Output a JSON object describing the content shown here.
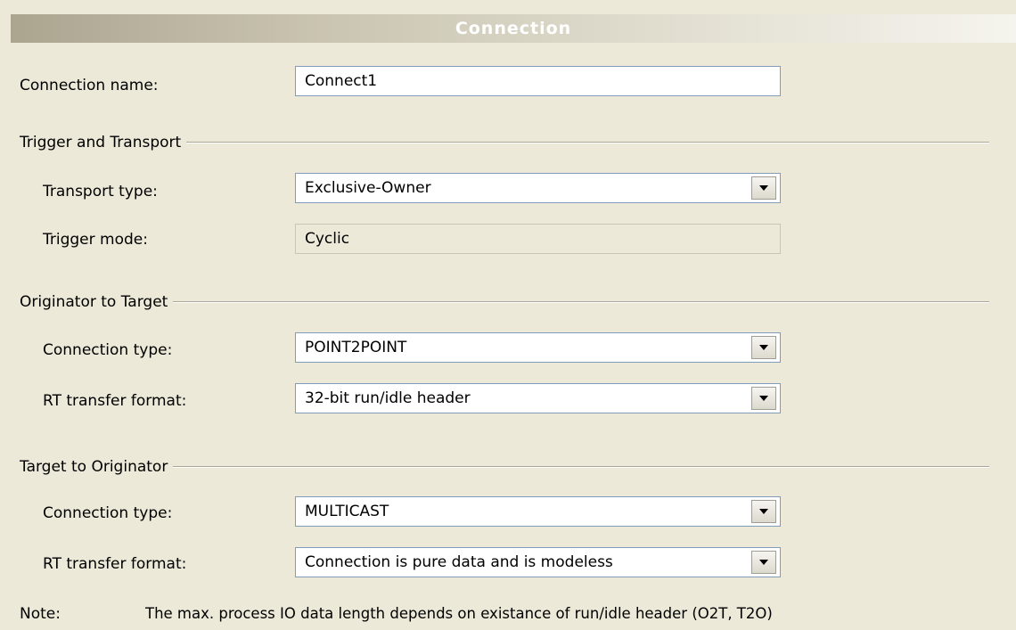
{
  "title": "Connection",
  "connection_name": {
    "label": "Connection name:",
    "value": "Connect1"
  },
  "trigger_transport": {
    "heading": "Trigger and Transport",
    "transport_type": {
      "label": "Transport type:",
      "value": "Exclusive-Owner"
    },
    "trigger_mode": {
      "label": "Trigger mode:",
      "value": "Cyclic"
    }
  },
  "o2t": {
    "heading": "Originator to Target",
    "connection_type": {
      "label": "Connection type:",
      "value": "POINT2POINT"
    },
    "rt_format": {
      "label": "RT transfer format:",
      "value": "32-bit run/idle header"
    }
  },
  "t2o": {
    "heading": "Target to Originator",
    "connection_type": {
      "label": "Connection type:",
      "value": "MULTICAST"
    },
    "rt_format": {
      "label": "RT transfer format:",
      "value": "Connection is pure data and is modeless"
    }
  },
  "note": {
    "label": "Note:",
    "text": "The max. process IO data length depends on existance of run/idle header (O2T, T2O)"
  },
  "icons": {
    "dropdown": "chevron-down-icon"
  }
}
